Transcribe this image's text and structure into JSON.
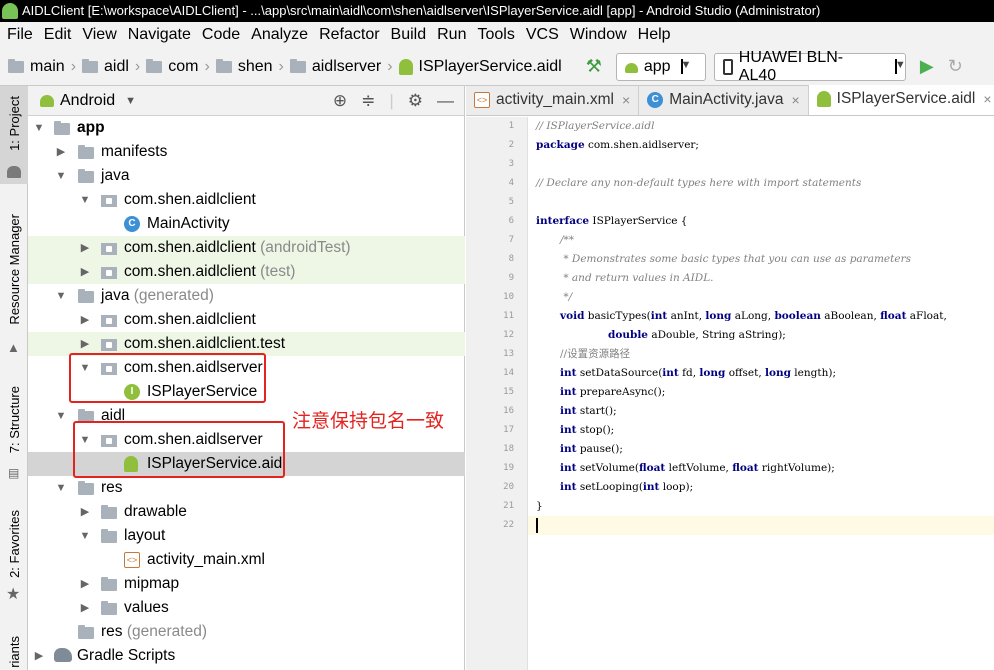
{
  "window": {
    "title": "AIDLClient [E:\\workspace\\AIDLClient] - ...\\app\\src\\main\\aidl\\com\\shen\\aidlserver\\ISPlayerService.aidl [app] - Android Studio (Administrator)"
  },
  "menu": [
    "File",
    "Edit",
    "View",
    "Navigate",
    "Code",
    "Analyze",
    "Refactor",
    "Build",
    "Run",
    "Tools",
    "VCS",
    "Window",
    "Help"
  ],
  "breadcrumb": [
    "main",
    "aidl",
    "com",
    "shen",
    "aidlserver",
    "ISPlayerService.aidl"
  ],
  "toolbar": {
    "run_config": "app",
    "device": "HUAWEI BLN-AL40"
  },
  "side_tabs": {
    "project": "1: Project",
    "resource_manager": "Resource Manager",
    "structure": "7: Structure",
    "favorites": "2: Favorites",
    "variants": "riants"
  },
  "project_panel": {
    "view_mode": "Android"
  },
  "tree": [
    {
      "label": "app",
      "suffix": ""
    },
    {
      "label": "manifests",
      "suffix": ""
    },
    {
      "label": "java",
      "suffix": ""
    },
    {
      "label": "com.shen.aidlclient",
      "suffix": ""
    },
    {
      "label": "MainActivity",
      "suffix": ""
    },
    {
      "label": "com.shen.aidlclient",
      "suffix": "(androidTest)"
    },
    {
      "label": "com.shen.aidlclient",
      "suffix": "(test)"
    },
    {
      "label": "java",
      "suffix": "(generated)"
    },
    {
      "label": "com.shen.aidlclient",
      "suffix": ""
    },
    {
      "label": "com.shen.aidlclient.test",
      "suffix": ""
    },
    {
      "label": "com.shen.aidlserver",
      "suffix": ""
    },
    {
      "label": "ISPlayerService",
      "suffix": ""
    },
    {
      "label": "aidl",
      "suffix": ""
    },
    {
      "label": "com.shen.aidlserver",
      "suffix": ""
    },
    {
      "label": "ISPlayerService.aidl",
      "suffix": ""
    },
    {
      "label": "res",
      "suffix": ""
    },
    {
      "label": "drawable",
      "suffix": ""
    },
    {
      "label": "layout",
      "suffix": ""
    },
    {
      "label": "activity_main.xml",
      "suffix": ""
    },
    {
      "label": "mipmap",
      "suffix": ""
    },
    {
      "label": "values",
      "suffix": ""
    },
    {
      "label": "res",
      "suffix": "(generated)"
    },
    {
      "label": "Gradle Scripts",
      "suffix": ""
    }
  ],
  "annotation": "注意保持包名一致",
  "editor_tabs": [
    "activity_main.xml",
    "MainActivity.java",
    "ISPlayerService.aidl"
  ],
  "code": {
    "line_numbers": [
      "1",
      "2",
      "3",
      "4",
      "5",
      "6",
      "7",
      "8",
      "9",
      "10",
      "11",
      "12",
      "13",
      "14",
      "15",
      "16",
      "17",
      "18",
      "19",
      "20",
      "21",
      "22"
    ],
    "l1": "// ISPlayerService.aidl",
    "l2_kw": "package",
    "l2_rest": " com.shen.aidlserver;",
    "l4": "// Declare any non-default types here with import statements",
    "l6_kw": "interface",
    "l6_rest": " ISPlayerService {",
    "l7": "/**",
    "l8": " * Demonstrates some basic types that you can use as parameters",
    "l9": " * and return values in AIDL.",
    "l10": " */",
    "l11_a": "void",
    "l11_b": " basicTypes(",
    "l11_c": "int",
    "l11_d": " anInt, ",
    "l11_e": "long",
    "l11_f": " aLong, ",
    "l11_g": "boolean",
    "l11_h": " aBoolean, ",
    "l11_i": "float",
    "l11_j": " aFloat,",
    "l12_a": "double",
    "l12_b": " aDouble, String aString);",
    "l13": "//设置资源路径",
    "l14_a": "int",
    "l14_b": " setDataSource(",
    "l14_c": "int",
    "l14_d": " fd, ",
    "l14_e": "long",
    "l14_f": " offset, ",
    "l14_g": "long",
    "l14_h": " length);",
    "l15_a": "int",
    "l15_b": " prepareAsync();",
    "l16_a": "int",
    "l16_b": " start();",
    "l17_a": "int",
    "l17_b": " stop();",
    "l18_a": "int",
    "l18_b": " pause();",
    "l19_a": "int",
    "l19_b": " setVolume(",
    "l19_c": "float",
    "l19_d": " leftVolume, ",
    "l19_e": "float",
    "l19_f": " rightVolume);",
    "l20_a": "int",
    "l20_b": " setLooping(",
    "l20_c": "int",
    "l20_d": " loop);",
    "l21": "}"
  }
}
